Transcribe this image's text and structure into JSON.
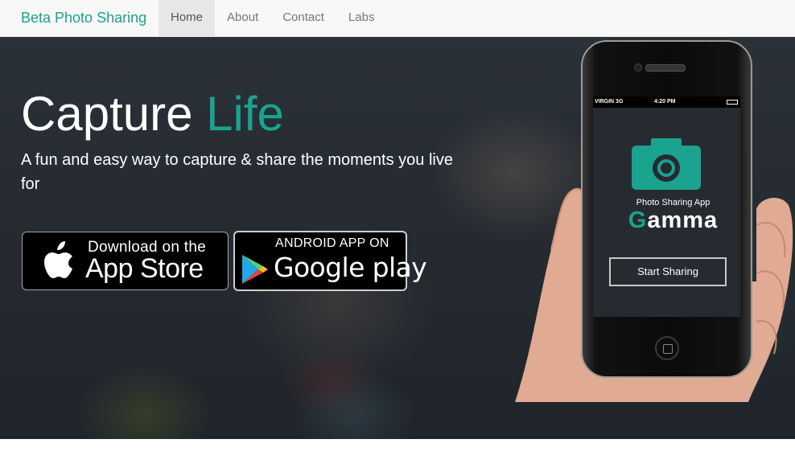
{
  "navbar": {
    "brand": "Beta Photo Sharing",
    "items": [
      {
        "label": "Home",
        "active": true
      },
      {
        "label": "About",
        "active": false
      },
      {
        "label": "Contact",
        "active": false
      },
      {
        "label": "Labs",
        "active": false
      }
    ]
  },
  "hero": {
    "headline_main": "Capture",
    "headline_accent": "Life",
    "tagline": "A fun and easy way to capture & share the moments you live for",
    "accent_color": "#1aa38e",
    "app_store": {
      "small": "Download on the",
      "big": "App Store",
      "icon": "apple-icon"
    },
    "google_play": {
      "small": "ANDROID APP ON",
      "big": "Google play",
      "icon": "google-play-icon"
    }
  },
  "phone": {
    "status_carrier": "VIRGIN  3G",
    "status_time": "4:20 PM",
    "app_subtitle": "Photo Sharing App",
    "app_name_first": "G",
    "app_name_rest": "amma",
    "button_label": "Start Sharing",
    "icon": "camera-icon"
  }
}
